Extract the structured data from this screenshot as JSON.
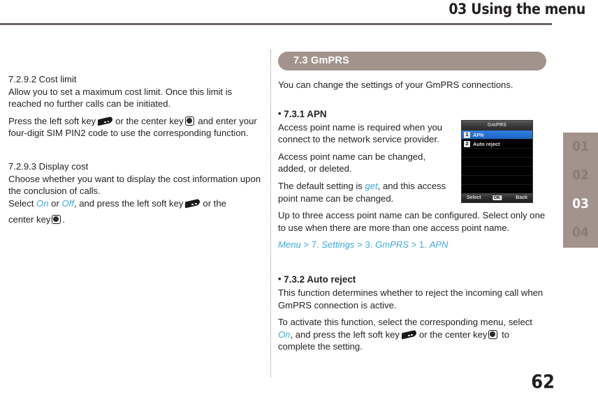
{
  "header": {
    "chapter_label": "03 Using the menu"
  },
  "left_column": {
    "sections": [
      {
        "heading": "7.2.9.2 Cost limit",
        "paragraphs": [
          "Allow you to set a maximum cost limit. Once this limit is reached no further calls can be initiated.",
          "Press the left soft key",
          "or the center key",
          "and enter your four-digit SIM PIN2 code to use the corresponding function."
        ]
      },
      {
        "heading": "7.2.9.3 Display cost",
        "paragraphs": [
          "Choose whether you want to display the cost information upon the conclusion of calls.",
          "Select",
          "On",
          "or",
          "Off",
          ", and press the left soft key",
          "or the",
          "center key",
          "."
        ]
      }
    ]
  },
  "right_column": {
    "section_pill": "7.3  GmPRS",
    "intro": "You can change the settings of your GmPRS connections.",
    "subsections": [
      {
        "bullet": "•",
        "title": "7.3.1  APN",
        "paragraphs": [
          "Access point name is required when you connect to the network service provider.",
          "Access point name can be changed, added, or deleted.",
          "The default setting is",
          "get",
          ", and this access point name can be changed.",
          "Up to three access point name can be configured. Select only one to use when there are more than one access point name."
        ],
        "menu_path": {
          "root": "Menu",
          "sep": " > ",
          "step1_num": "7. ",
          "step1": "Settings",
          "step2_num": "3. ",
          "step2": "GmPRS",
          "step3_num": "1. ",
          "step3": "APN"
        }
      },
      {
        "bullet": "•",
        "title": "7.3.2  Auto reject",
        "paragraphs": [
          "This function determines whether to reject the incoming call when GmPRS connection is active.",
          "To activate this function, select the corresponding menu, select",
          "On",
          ", and press the left soft key",
          "or the center key",
          "to complete the setting."
        ]
      }
    ]
  },
  "phone_screenshot": {
    "title": "GmPRS",
    "items": [
      {
        "num": "1",
        "label": "APN",
        "selected": true
      },
      {
        "num": "2",
        "label": "Auto reject",
        "selected": false
      }
    ],
    "softkeys": {
      "left": "Select",
      "center": "OK",
      "right": "Back"
    }
  },
  "tab_rail": {
    "items": [
      {
        "label": "01",
        "active": false
      },
      {
        "label": "02",
        "active": false
      },
      {
        "label": "03",
        "active": true
      },
      {
        "label": "04",
        "active": false
      }
    ]
  },
  "footer": {
    "page_number": "62"
  },
  "colors": {
    "accent_brown": "#a2938c",
    "rule": "#6e6460",
    "link_blue": "#3fa9dc",
    "text": "#231f20",
    "phone_select_blue": "#2f7fe0"
  }
}
